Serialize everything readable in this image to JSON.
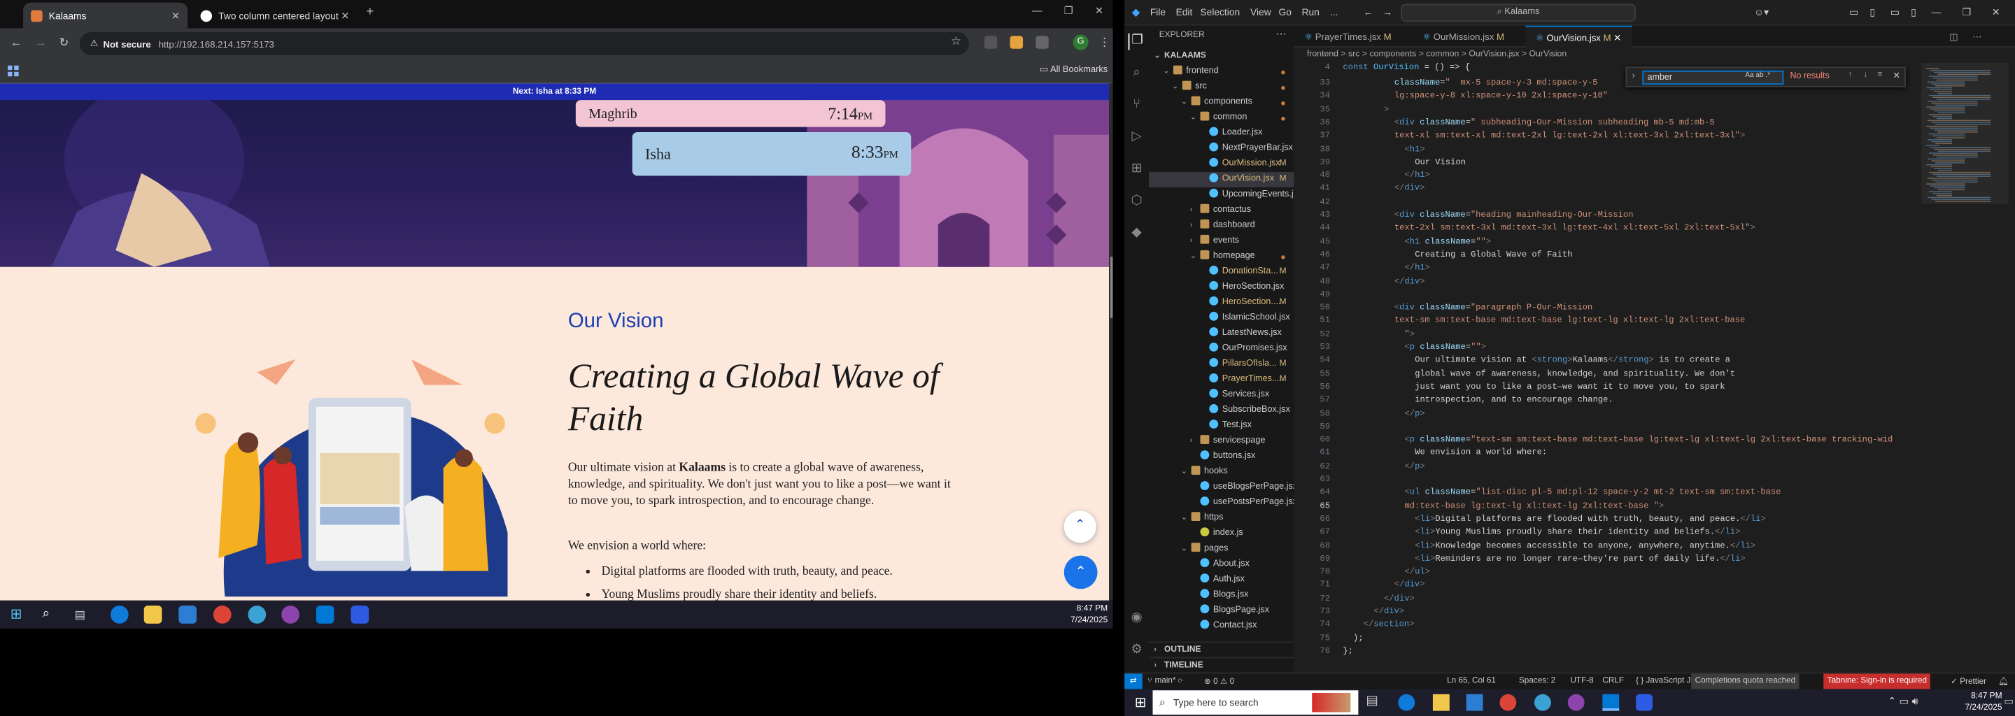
{
  "browser": {
    "tabs": [
      {
        "label": "Kalaams",
        "active": true
      },
      {
        "label": "Two column centered layout",
        "active": false
      }
    ],
    "address": {
      "not_secure": "Not secure",
      "url": "http://192.168.214.157:5173"
    },
    "bookmarks_label": "All Bookmarks",
    "avatar_letter": "G"
  },
  "page": {
    "next_prayer": "Next: Isha at 8:33 PM",
    "prayers": [
      {
        "name": "Maghrib",
        "time": "7:14",
        "ampm": "PM"
      },
      {
        "name": "Isha",
        "time": "8:33",
        "ampm": "PM"
      }
    ],
    "subheading": "Our Vision",
    "heading": "Creating a Global Wave of Faith",
    "paragraph_pre": "Our ultimate vision at ",
    "paragraph_brand": "Kalaams",
    "paragraph_post": " is to create a global wave of awareness, knowledge, and spirituality. We don't just want you to like a post—we want it to move you, to spark introspection, and to encourage change.",
    "envision": "We envision a world where:",
    "bullets": [
      "Digital platforms are flooded with truth, beauty, and peace.",
      "Young Muslims proudly share their identity and beliefs."
    ],
    "colors": {
      "accent": "#1a3fb5",
      "page_bg": "#fde8dc",
      "next_bar": "#1f2bb3"
    }
  },
  "taskbar_left": {
    "time": "8:47 PM",
    "date": "7/24/2025"
  },
  "vscode": {
    "menu": [
      "File",
      "Edit",
      "Selection",
      "View",
      "Go",
      "Run",
      "..."
    ],
    "command_center": "Kalaams",
    "explorer_title": "EXPLORER",
    "root": "KALAAMS",
    "tree": [
      {
        "label": "frontend",
        "depth": 1,
        "type": "folder",
        "open": true,
        "dot": true
      },
      {
        "label": "src",
        "depth": 2,
        "type": "folder",
        "open": true,
        "dot": true
      },
      {
        "label": "components",
        "depth": 3,
        "type": "folder",
        "open": true,
        "dot": true
      },
      {
        "label": "common",
        "depth": 4,
        "type": "folder",
        "open": true,
        "dot": true
      },
      {
        "label": "Loader.jsx",
        "depth": 5,
        "type": "file"
      },
      {
        "label": "NextPrayerBar.jsx",
        "depth": 5,
        "type": "file"
      },
      {
        "label": "OurMission.jsx",
        "depth": 5,
        "type": "file",
        "mark": "M"
      },
      {
        "label": "OurVision.jsx",
        "depth": 5,
        "type": "file",
        "mark": "M",
        "selected": true
      },
      {
        "label": "UpcomingEvents.jsx",
        "depth": 5,
        "type": "file"
      },
      {
        "label": "contactus",
        "depth": 4,
        "type": "folder"
      },
      {
        "label": "dashboard",
        "depth": 4,
        "type": "folder"
      },
      {
        "label": "events",
        "depth": 4,
        "type": "folder"
      },
      {
        "label": "homepage",
        "depth": 4,
        "type": "folder",
        "open": true,
        "dot": true
      },
      {
        "label": "DonationSta...",
        "depth": 5,
        "type": "file",
        "mark": "M"
      },
      {
        "label": "HeroSection.jsx",
        "depth": 5,
        "type": "file"
      },
      {
        "label": "HeroSection....",
        "depth": 5,
        "type": "file",
        "mark": "M"
      },
      {
        "label": "IslamicSchool.jsx",
        "depth": 5,
        "type": "file"
      },
      {
        "label": "LatestNews.jsx",
        "depth": 5,
        "type": "file"
      },
      {
        "label": "OurPromises.jsx",
        "depth": 5,
        "type": "file"
      },
      {
        "label": "PillarsOfIsla...",
        "depth": 5,
        "type": "file",
        "mark": "M"
      },
      {
        "label": "PrayerTimes....",
        "depth": 5,
        "type": "file",
        "mark": "M"
      },
      {
        "label": "Services.jsx",
        "depth": 5,
        "type": "file"
      },
      {
        "label": "SubscribeBox.jsx",
        "depth": 5,
        "type": "file"
      },
      {
        "label": "Test.jsx",
        "depth": 5,
        "type": "file"
      },
      {
        "label": "servicespage",
        "depth": 4,
        "type": "folder"
      },
      {
        "label": "buttons.jsx",
        "depth": 4,
        "type": "file"
      },
      {
        "label": "hooks",
        "depth": 3,
        "type": "folder",
        "open": true
      },
      {
        "label": "useBlogsPerPage.jsx",
        "depth": 4,
        "type": "file"
      },
      {
        "label": "usePostsPerPage.jsx",
        "depth": 4,
        "type": "file"
      },
      {
        "label": "https",
        "depth": 3,
        "type": "folder",
        "open": true
      },
      {
        "label": "index.js",
        "depth": 4,
        "type": "file"
      },
      {
        "label": "pages",
        "depth": 3,
        "type": "folder",
        "open": true
      },
      {
        "label": "About.jsx",
        "depth": 4,
        "type": "file"
      },
      {
        "label": "Auth.jsx",
        "depth": 4,
        "type": "file"
      },
      {
        "label": "Blogs.jsx",
        "depth": 4,
        "type": "file"
      },
      {
        "label": "BlogsPage.jsx",
        "depth": 4,
        "type": "file"
      },
      {
        "label": "Contact.jsx",
        "depth": 4,
        "type": "file"
      }
    ],
    "outline": "OUTLINE",
    "timeline": "TIMELINE",
    "editor_tabs": [
      {
        "label": "PrayerTimes.jsx",
        "mark": "M"
      },
      {
        "label": "OurMission.jsx",
        "mark": "M"
      },
      {
        "label": "OurVision.jsx",
        "mark": "M",
        "active": true
      }
    ],
    "breadcrumb": "frontend > src > components > common > OurVision.jsx > OurVision",
    "sticky_line": {
      "n": "4",
      "text": "const OurVision = () => {"
    },
    "find": {
      "query": "amber",
      "result": "No results"
    },
    "code": [
      {
        "n": "33",
        "h": [
          [
            "a",
            "className"
          ],
          [
            "w",
            "="
          ],
          [
            "s",
            "\"  mx-5 space-y-3 md:space-y-5"
          ]
        ],
        "i": 5
      },
      {
        "n": "34",
        "h": [
          [
            "s",
            "lg:space-y-8 xl:space-y-10 2xl:space-y-10\""
          ]
        ],
        "i": 5
      },
      {
        "n": "35",
        "h": [
          [
            "p",
            ">"
          ]
        ],
        "i": 4
      },
      {
        "n": "36",
        "h": [
          [
            "p",
            "<"
          ],
          [
            "t",
            "div "
          ],
          [
            "a",
            "className"
          ],
          [
            "w",
            "="
          ],
          [
            "s",
            "\" subheading-Our-Mission subheading mb-5 md:mb-5"
          ]
        ],
        "i": 5
      },
      {
        "n": "37",
        "h": [
          [
            "s",
            "text-xl sm:text-xl md:text-2xl lg:text-2xl xl:text-3xl 2xl:text-3xl\""
          ],
          [
            "p",
            ">"
          ]
        ],
        "i": 5
      },
      {
        "n": "38",
        "h": [
          [
            "p",
            "<"
          ],
          [
            "t",
            "h1"
          ],
          [
            "p",
            ">"
          ]
        ],
        "i": 6
      },
      {
        "n": "39",
        "h": [
          [
            "w",
            "Our Vision"
          ]
        ],
        "i": 7
      },
      {
        "n": "40",
        "h": [
          [
            "p",
            "</"
          ],
          [
            "t",
            "h1"
          ],
          [
            "p",
            ">"
          ]
        ],
        "i": 6
      },
      {
        "n": "41",
        "h": [
          [
            "p",
            "</"
          ],
          [
            "t",
            "div"
          ],
          [
            "p",
            ">"
          ]
        ],
        "i": 5
      },
      {
        "n": "42",
        "h": [],
        "i": 0
      },
      {
        "n": "43",
        "h": [
          [
            "p",
            "<"
          ],
          [
            "t",
            "div "
          ],
          [
            "a",
            "className"
          ],
          [
            "w",
            "="
          ],
          [
            "s",
            "\"heading mainheading-Our-Mission"
          ]
        ],
        "i": 5
      },
      {
        "n": "44",
        "h": [
          [
            "s",
            "text-2xl sm:text-3xl md:text-3xl lg:text-4xl xl:text-5xl 2xl:text-5xl\""
          ],
          [
            "p",
            ">"
          ]
        ],
        "i": 5
      },
      {
        "n": "45",
        "h": [
          [
            "p",
            "<"
          ],
          [
            "t",
            "h1 "
          ],
          [
            "a",
            "className"
          ],
          [
            "w",
            "="
          ],
          [
            "s",
            "\"\""
          ],
          [
            "p",
            ">"
          ]
        ],
        "i": 6
      },
      {
        "n": "46",
        "h": [
          [
            "w",
            "Creating a Global Wave of Faith"
          ]
        ],
        "i": 7
      },
      {
        "n": "47",
        "h": [
          [
            "p",
            "</"
          ],
          [
            "t",
            "h1"
          ],
          [
            "p",
            ">"
          ]
        ],
        "i": 6
      },
      {
        "n": "48",
        "h": [
          [
            "p",
            "</"
          ],
          [
            "t",
            "div"
          ],
          [
            "p",
            ">"
          ]
        ],
        "i": 5
      },
      {
        "n": "49",
        "h": [],
        "i": 0
      },
      {
        "n": "50",
        "h": [
          [
            "p",
            "<"
          ],
          [
            "t",
            "div "
          ],
          [
            "a",
            "className"
          ],
          [
            "w",
            "="
          ],
          [
            "s",
            "\"paragraph P-Our-Mission"
          ]
        ],
        "i": 5
      },
      {
        "n": "51",
        "h": [
          [
            "s",
            "text-sm sm:text-base md:text-base lg:text-lg xl:text-lg 2xl:text-base"
          ]
        ],
        "i": 5
      },
      {
        "n": "52",
        "h": [
          [
            "s",
            "\""
          ],
          [
            "p",
            ">"
          ]
        ],
        "i": 6
      },
      {
        "n": "53",
        "h": [
          [
            "p",
            "<"
          ],
          [
            "t",
            "p "
          ],
          [
            "a",
            "className"
          ],
          [
            "w",
            "="
          ],
          [
            "s",
            "\"\""
          ],
          [
            "p",
            ">"
          ]
        ],
        "i": 6
      },
      {
        "n": "54",
        "h": [
          [
            "w",
            "Our ultimate vision at "
          ],
          [
            "p",
            "<"
          ],
          [
            "t",
            "strong"
          ],
          [
            "p",
            ">"
          ],
          [
            "w",
            "Kalaams"
          ],
          [
            "p",
            "</"
          ],
          [
            "t",
            "strong"
          ],
          [
            "p",
            ">"
          ],
          [
            "w",
            " is to create a"
          ]
        ],
        "i": 7
      },
      {
        "n": "55",
        "h": [
          [
            "w",
            "global wave of awareness, knowledge, and spirituality. We don't"
          ]
        ],
        "i": 7
      },
      {
        "n": "56",
        "h": [
          [
            "w",
            "just want you to like a post—we want it to move you, to spark"
          ]
        ],
        "i": 7
      },
      {
        "n": "57",
        "h": [
          [
            "w",
            "introspection, and to encourage change."
          ]
        ],
        "i": 7
      },
      {
        "n": "58",
        "h": [
          [
            "p",
            "</"
          ],
          [
            "t",
            "p"
          ],
          [
            "p",
            ">"
          ]
        ],
        "i": 6
      },
      {
        "n": "59",
        "h": [],
        "i": 0
      },
      {
        "n": "60",
        "h": [
          [
            "p",
            "<"
          ],
          [
            "t",
            "p "
          ],
          [
            "a",
            "className"
          ],
          [
            "w",
            "="
          ],
          [
            "s",
            "\"text-sm sm:text-base md:text-base lg:text-lg xl:text-lg 2xl:text-base tracking-wid"
          ]
        ],
        "i": 6
      },
      {
        "n": "61",
        "h": [
          [
            "w",
            "We envision a world where:"
          ]
        ],
        "i": 7
      },
      {
        "n": "62",
        "h": [
          [
            "p",
            "</"
          ],
          [
            "t",
            "p"
          ],
          [
            "p",
            ">"
          ]
        ],
        "i": 6
      },
      {
        "n": "63",
        "h": [],
        "i": 0
      },
      {
        "n": "64",
        "h": [
          [
            "p",
            "<"
          ],
          [
            "t",
            "ul "
          ],
          [
            "a",
            "className"
          ],
          [
            "w",
            "="
          ],
          [
            "s",
            "\"list-disc pl-5 md:pl-12 space-y-2 mt-2 text-sm sm:text-base"
          ]
        ],
        "i": 6
      },
      {
        "n": "65",
        "h": [
          [
            "s",
            "md:text-base lg:text-lg xl:text-lg 2xl:text-base \""
          ],
          [
            "p",
            ">"
          ]
        ],
        "i": 6
      },
      {
        "n": "66",
        "h": [
          [
            "p",
            "<"
          ],
          [
            "t",
            "li"
          ],
          [
            "p",
            ">"
          ],
          [
            "w",
            "Digital platforms are flooded with truth, beauty, and peace."
          ],
          [
            "p",
            "</"
          ],
          [
            "t",
            "li"
          ],
          [
            "p",
            ">"
          ]
        ],
        "i": 7
      },
      {
        "n": "67",
        "h": [
          [
            "p",
            "<"
          ],
          [
            "t",
            "li"
          ],
          [
            "p",
            ">"
          ],
          [
            "w",
            "Young Muslims proudly share their identity and beliefs."
          ],
          [
            "p",
            "</"
          ],
          [
            "t",
            "li"
          ],
          [
            "p",
            ">"
          ]
        ],
        "i": 7
      },
      {
        "n": "68",
        "h": [
          [
            "p",
            "<"
          ],
          [
            "t",
            "li"
          ],
          [
            "p",
            ">"
          ],
          [
            "w",
            "Knowledge becomes accessible to anyone, anywhere, anytime."
          ],
          [
            "p",
            "</"
          ],
          [
            "t",
            "li"
          ],
          [
            "p",
            ">"
          ]
        ],
        "i": 7
      },
      {
        "n": "69",
        "h": [
          [
            "p",
            "<"
          ],
          [
            "t",
            "li"
          ],
          [
            "p",
            ">"
          ],
          [
            "w",
            "Reminders are no longer rare—they're part of daily life."
          ],
          [
            "p",
            "</"
          ],
          [
            "t",
            "li"
          ],
          [
            "p",
            ">"
          ]
        ],
        "i": 7
      },
      {
        "n": "70",
        "h": [
          [
            "p",
            "</"
          ],
          [
            "t",
            "ul"
          ],
          [
            "p",
            ">"
          ]
        ],
        "i": 6
      },
      {
        "n": "71",
        "h": [
          [
            "p",
            "</"
          ],
          [
            "t",
            "div"
          ],
          [
            "p",
            ">"
          ]
        ],
        "i": 5
      },
      {
        "n": "72",
        "h": [
          [
            "p",
            "</"
          ],
          [
            "t",
            "div"
          ],
          [
            "p",
            ">"
          ]
        ],
        "i": 4
      },
      {
        "n": "73",
        "h": [
          [
            "p",
            "</"
          ],
          [
            "t",
            "div"
          ],
          [
            "p",
            ">"
          ]
        ],
        "i": 3
      },
      {
        "n": "74",
        "h": [
          [
            "p",
            "</"
          ],
          [
            "t",
            "section"
          ],
          [
            "p",
            ">"
          ]
        ],
        "i": 2
      },
      {
        "n": "75",
        "h": [
          [
            "w",
            ");"
          ]
        ],
        "i": 1
      },
      {
        "n": "76",
        "h": [
          [
            "w",
            "};"
          ]
        ],
        "i": 0
      }
    ],
    "status": {
      "branch": "main*",
      "errors": "⊗ 0 ⚠ 0",
      "position": "Ln 65, Col 61",
      "spaces": "Spaces: 2",
      "encoding": "UTF-8",
      "eol": "CRLF",
      "language": "{ } JavaScript JSX",
      "quota": "Completions quota reached",
      "tabnine": "Tabnine: Sign-in is required",
      "prettier": "✓ Prettier"
    },
    "colors": {
      "accent": "#0078d4",
      "modified": "#d7ba7d"
    }
  },
  "windows_taskbar": {
    "search_placeholder": "Type here to search",
    "time": "8:47 PM",
    "date": "7/24/2025"
  }
}
